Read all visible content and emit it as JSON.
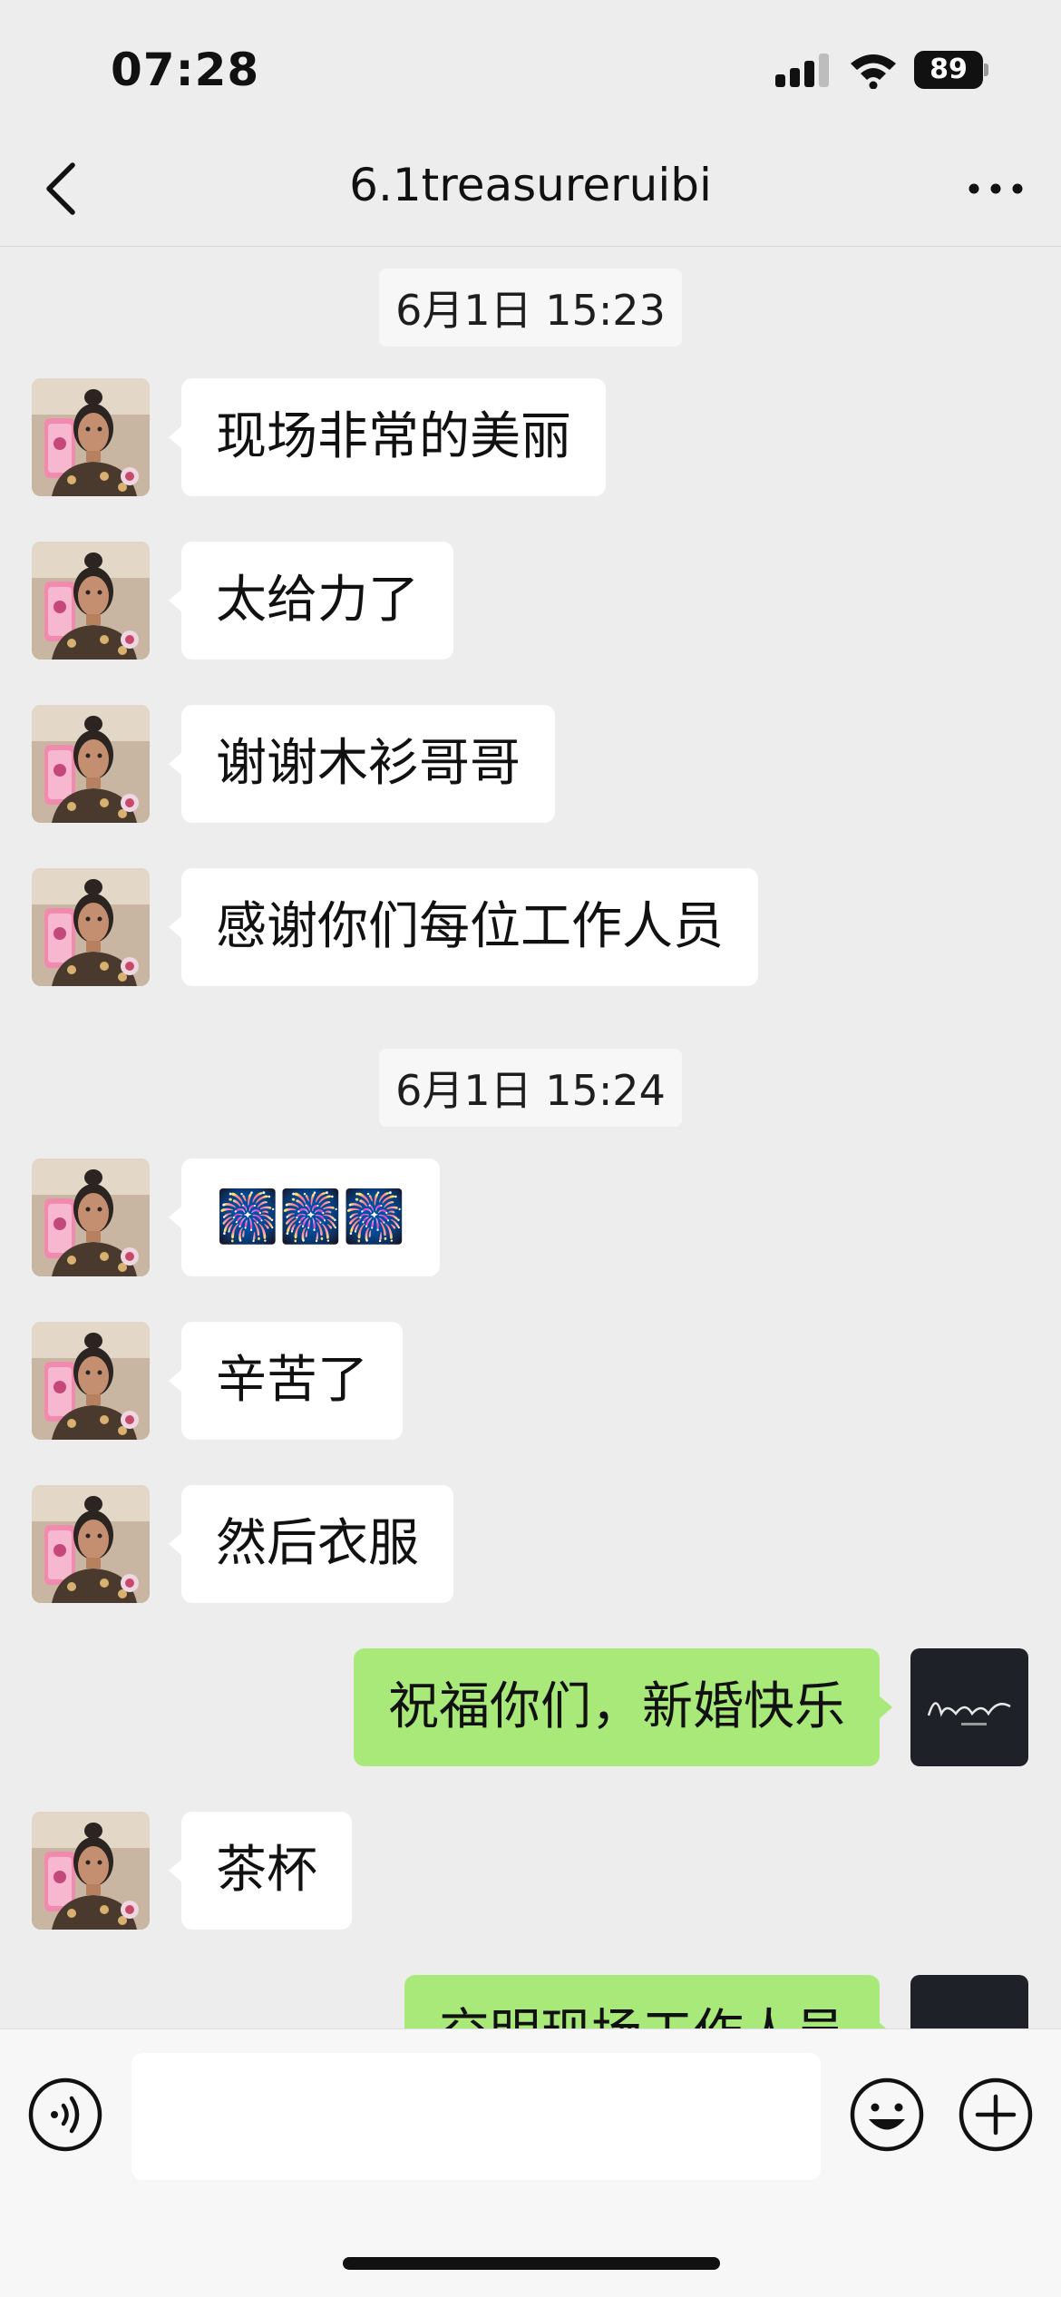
{
  "status_bar": {
    "time": "07:28",
    "battery": "89"
  },
  "header": {
    "title": "6.1treasureruibi"
  },
  "chat": {
    "timestamps": [
      "6月1日 15:23",
      "6月1日 15:24"
    ],
    "messages": [
      {
        "side": "left",
        "text": "现场非常的美丽"
      },
      {
        "side": "left",
        "text": "太给力了"
      },
      {
        "side": "left",
        "text": "谢谢木衫哥哥"
      },
      {
        "side": "left",
        "text": "感谢你们每位工作人员"
      },
      {
        "side": "left",
        "text": "🎆🎆🎆"
      },
      {
        "side": "left",
        "text": "辛苦了"
      },
      {
        "side": "left",
        "text": "然后衣服"
      },
      {
        "side": "right",
        "text": "祝福你们，新婚快乐"
      },
      {
        "side": "left",
        "text": "茶杯"
      },
      {
        "side": "right",
        "text": "交明现场工作人员"
      }
    ],
    "own_avatar_text": "Avante"
  },
  "input_bar": {
    "value": ""
  },
  "icons": [
    "back-icon",
    "more-icon",
    "voice-icon",
    "emoji-icon",
    "plus-icon",
    "wifi-icon",
    "signal-icon",
    "battery-icon"
  ],
  "colors": {
    "background": "#ededed",
    "sent_bubble": "#a9e979",
    "received_bubble": "#ffffff"
  }
}
